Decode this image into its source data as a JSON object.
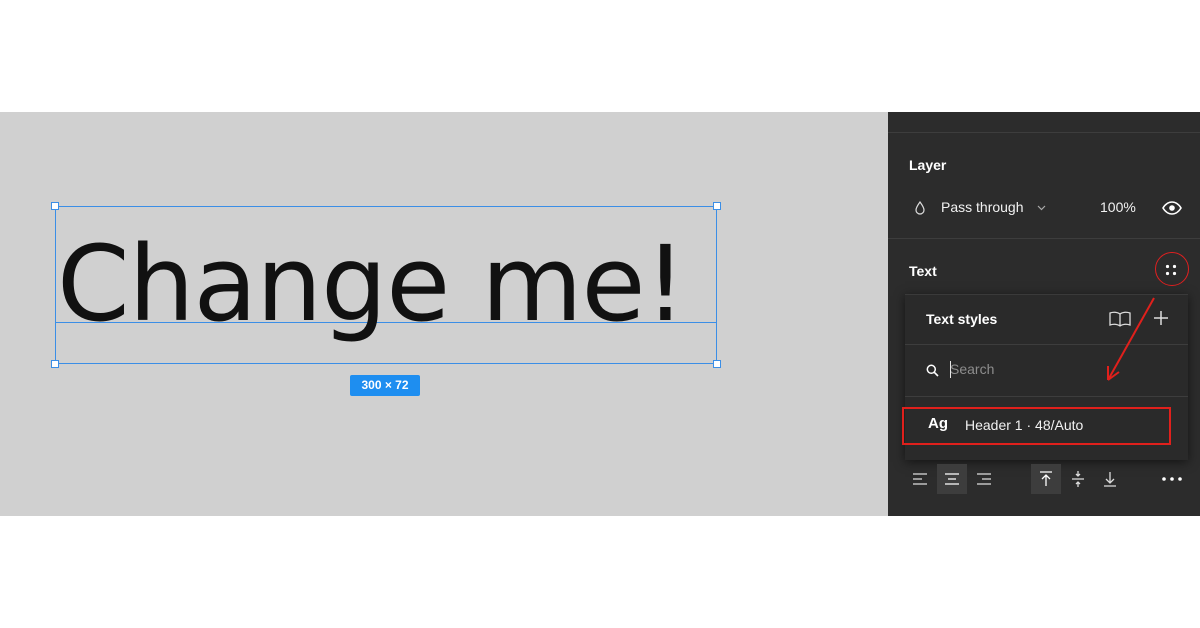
{
  "canvas": {
    "text": "Change me!",
    "size_badge": "300 × 72"
  },
  "panel": {
    "layer": {
      "title": "Layer",
      "blend_mode": "Pass through",
      "opacity": "100%"
    },
    "text_section": {
      "title": "Text"
    },
    "text_styles_popover": {
      "title": "Text styles",
      "search_placeholder": "Search",
      "styles": [
        {
          "preview": "Ag",
          "name": "Header 1 · 48/Auto"
        }
      ]
    }
  },
  "colors": {
    "canvas_bg": "#d0d0d0",
    "panel_bg": "#2c2c2c",
    "selection": "#3b8ee6",
    "badge": "#1e8ef0",
    "annotation": "#e0201c"
  },
  "icons": [
    "drop-icon",
    "chevron-down-icon",
    "eye-icon",
    "styles-grid-icon",
    "book-icon",
    "plus-icon",
    "search-icon",
    "align-left-icon",
    "align-center-icon",
    "align-right-icon",
    "align-top-icon",
    "align-middle-icon",
    "align-bottom-icon",
    "more-icon"
  ]
}
